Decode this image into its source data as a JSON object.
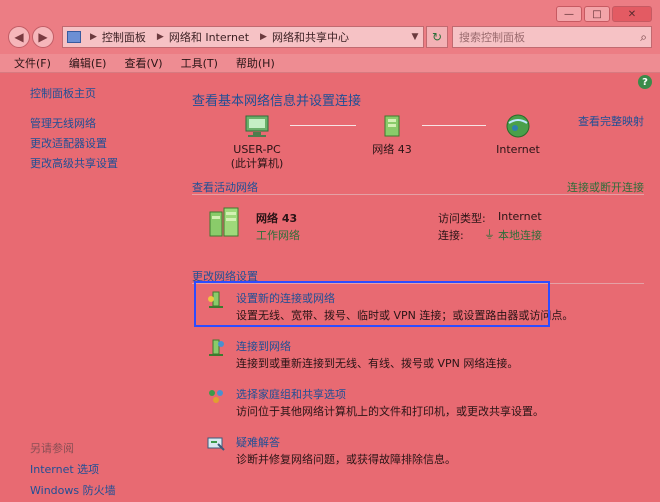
{
  "window": {
    "caption": {
      "minimize": "—",
      "maximize": "□",
      "close": "✕"
    }
  },
  "nav": {
    "back_icon": "back-arrow-icon",
    "forward_icon": "forward-arrow-icon"
  },
  "address": {
    "crumbs": [
      "控制面板",
      "网络和 Internet",
      "网络和共享中心"
    ],
    "dropdown_icon": "chevron-down-icon"
  },
  "search": {
    "placeholder": "搜索控制面板",
    "icon": "search-icon"
  },
  "menu": {
    "file": "文件(F)",
    "edit": "编辑(E)",
    "view": "查看(V)",
    "tools": "工具(T)",
    "help": "帮助(H)"
  },
  "sidebar": {
    "home": "控制面板主页",
    "links": [
      "管理无线网络",
      "更改适配器设置",
      "更改高级共享设置"
    ],
    "see_also_title": "另请参阅",
    "see_also": [
      "Internet 选项",
      "Windows 防火墙"
    ]
  },
  "main": {
    "title": "查看基本网络信息并设置连接",
    "full_map": "查看完整映射",
    "nodes": {
      "computer_name": "USER-PC",
      "computer_sub": "(此计算机)",
      "network": "网络  43",
      "internet": "Internet"
    },
    "active_title": "查看活动网络",
    "connect_link": "连接或断开连接",
    "active": {
      "name": "网络  43",
      "type": "工作网络",
      "access_label": "访问类型:",
      "access_value": "Internet",
      "conn_label": "连接:",
      "conn_value": "本地连接"
    },
    "change_title": "更改网络设置",
    "tasks": [
      {
        "title": "设置新的连接或网络",
        "desc": "设置无线、宽带、拨号、临时或 VPN 连接；或设置路由器或访问点。"
      },
      {
        "title": "连接到网络",
        "desc": "连接到或重新连接到无线、有线、拨号或 VPN 网络连接。"
      },
      {
        "title": "选择家庭组和共享选项",
        "desc": "访问位于其他网络计算机上的文件和打印机，或更改共享设置。"
      },
      {
        "title": "疑难解答",
        "desc": "诊断并修复网络问题，或获得故障排除信息。"
      }
    ]
  },
  "colors": {
    "background": "#e86a72",
    "link": "#1f4f96",
    "highlight_border": "#2d4cff"
  }
}
